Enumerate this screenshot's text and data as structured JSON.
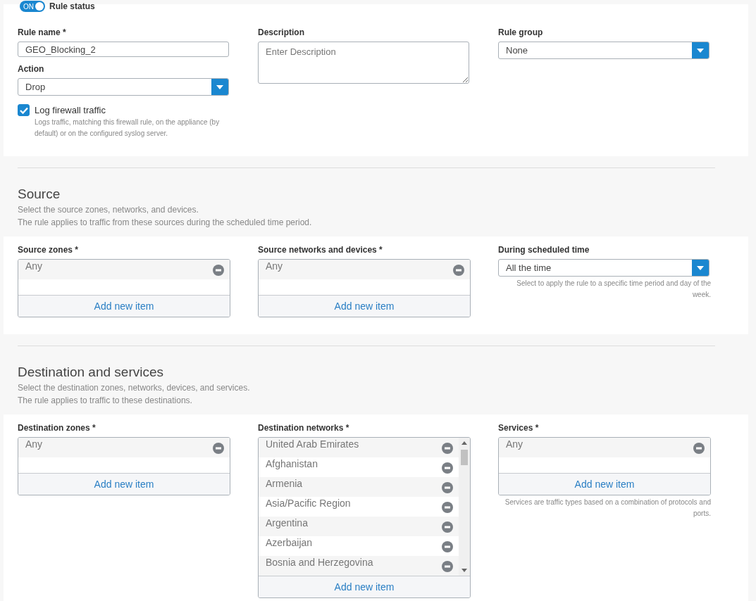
{
  "rule_status": {
    "toggle_text": "ON",
    "on": true,
    "label": "Rule status"
  },
  "general": {
    "columns": [
      {
        "fields": [
          {
            "kind": "text",
            "label": "Rule name *",
            "value": "GEO_Blocking_2"
          },
          {
            "kind": "select",
            "label": "Action",
            "value": "Drop"
          },
          {
            "kind": "checkbox",
            "label": "Log firewall traffic",
            "checked": true,
            "hint": "Logs traffic, matching this firewall rule, on the appliance (by default) or on the configured syslog server."
          }
        ]
      },
      {
        "fields": [
          {
            "kind": "textarea",
            "label": "Description",
            "placeholder": "Enter Description"
          }
        ]
      },
      {
        "fields": [
          {
            "kind": "select",
            "label": "Rule group",
            "value": "None"
          }
        ]
      }
    ]
  },
  "sections": [
    {
      "title": "Source",
      "subtitle": [
        "Select the source zones, networks, and devices.",
        "The rule applies to traffic from these sources during the scheduled time period."
      ],
      "columns": [
        {
          "fields": [
            {
              "kind": "list",
              "label": "Source zones *",
              "items": [
                "Any"
              ],
              "add_label": "Add new item"
            }
          ]
        },
        {
          "fields": [
            {
              "kind": "list",
              "label": "Source networks and devices *",
              "items": [
                "Any"
              ],
              "add_label": "Add new item"
            }
          ]
        },
        {
          "fields": [
            {
              "kind": "select",
              "label": "During scheduled time",
              "value": "All the time",
              "hint": "Select to apply the rule to a specific time period and day of the week."
            }
          ]
        }
      ]
    },
    {
      "title": "Destination and services",
      "subtitle": [
        "Select the destination zones, networks, devices, and services.",
        "The rule applies to traffic to these destinations."
      ],
      "columns": [
        {
          "fields": [
            {
              "kind": "list",
              "label": "Destination zones *",
              "items": [
                "Any"
              ],
              "add_label": "Add new item"
            }
          ]
        },
        {
          "fields": [
            {
              "kind": "list",
              "label": "Destination networks *",
              "items": [
                "United Arab Emirates",
                "Afghanistan",
                "Armenia",
                "Asia/Pacific Region",
                "Argentina",
                "Azerbaijan",
                "Bosnia and Herzegovina"
              ],
              "add_label": "Add new item"
            }
          ]
        },
        {
          "fields": [
            {
              "kind": "list",
              "label": "Services *",
              "items": [
                "Any"
              ],
              "add_label": "Add new item",
              "hint": "Services are traffic types based on a combination of protocols and ports."
            }
          ]
        }
      ]
    }
  ]
}
